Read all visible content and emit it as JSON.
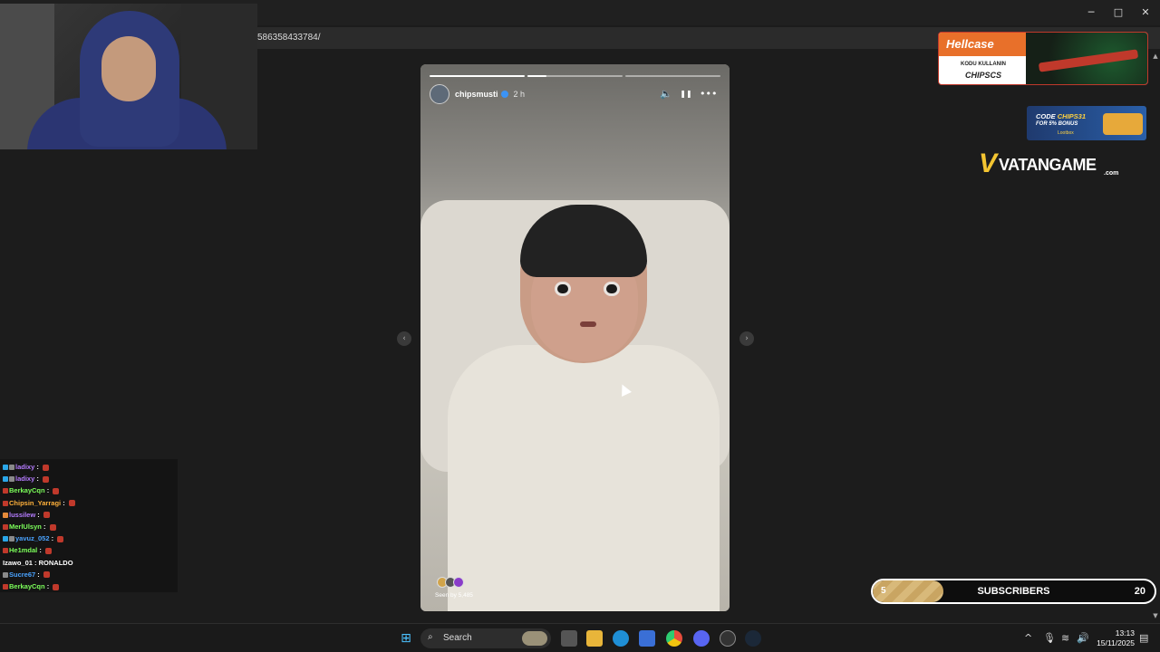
{
  "browser": {
    "url": "586358433784/",
    "controls": {
      "minimize": "─",
      "maximize": "□",
      "close": "✕"
    }
  },
  "chat": {
    "messages": [
      {
        "user": "ladixy",
        "color": "#b57cff",
        "badges": [
          "#2aa6e8",
          "#8a8a8a"
        ],
        "emote": true,
        "text": ""
      },
      {
        "user": "ladixy",
        "color": "#b57cff",
        "badges": [
          "#2aa6e8",
          "#8a8a8a"
        ],
        "emote": true,
        "text": ""
      },
      {
        "user": "BerkayCqn",
        "color": "#7cff5a",
        "badges": [
          "#c0392b"
        ],
        "emote": true,
        "text": ""
      },
      {
        "user": "Chipsin_Yarragi",
        "color": "#ffb03a",
        "badges": [
          "#c0392b"
        ],
        "emote": true,
        "text": ""
      },
      {
        "user": "lussilew",
        "color": "#b57cff",
        "badges": [
          "#e58a3a"
        ],
        "emote": true,
        "text": ""
      },
      {
        "user": "MerlUlsyn",
        "color": "#7cff5a",
        "badges": [
          "#c0392b"
        ],
        "emote": true,
        "text": ""
      },
      {
        "user": "yavuz_052",
        "color": "#4aa3ff",
        "badges": [
          "#2aa6e8",
          "#8a8a8a"
        ],
        "emote": true,
        "text": ""
      },
      {
        "user": "He1mdal",
        "color": "#7cff5a",
        "badges": [
          "#c0392b"
        ],
        "emote": true,
        "text": ""
      },
      {
        "user": "Izawo_01",
        "color": "#ffffff",
        "badges": [],
        "emote": false,
        "text": "RONALDO"
      },
      {
        "user": "Sucre67",
        "color": "#4aa3ff",
        "badges": [
          "#8a8a8a"
        ],
        "emote": true,
        "text": ""
      },
      {
        "user": "BerkayCqn",
        "color": "#7cff5a",
        "badges": [
          "#c0392b"
        ],
        "emote": true,
        "text": ""
      }
    ]
  },
  "story": {
    "username": "chipsmusti",
    "time": "2 h",
    "seen_by": "Seen by 5,485",
    "segments_total": 3,
    "segments_done": 1,
    "current_segment_progress": 0.2,
    "controls": {
      "mute": "🔈",
      "pause": "❚❚",
      "more": "•••"
    },
    "nav": {
      "prev": "‹",
      "next": "›"
    }
  },
  "ads": {
    "hellcase": {
      "brand": "Hellcase",
      "line1": "KODU KULLANIN",
      "line2": "CHIPSCS"
    },
    "lootbox": {
      "code_prefix": "CODE",
      "code": "CHIPS31",
      "bonus": "FOR 5% BONUS",
      "brand": "Lootbox"
    },
    "vatan": {
      "mark": "V",
      "name": "VATANGAME",
      "tld": ".com"
    }
  },
  "sub_goal": {
    "current": "5",
    "label": "SUBSCRIBERS",
    "goal": "20",
    "progress": 0.25
  },
  "taskbar": {
    "search_placeholder": "Search",
    "time": "13:13",
    "date": "15/11/2025",
    "apps": [
      "windows-start",
      "task-view",
      "file-explorer",
      "edge",
      "store",
      "chrome",
      "discord",
      "obs",
      "steam"
    ]
  },
  "colors": {
    "hellcase_orange": "#e8702a",
    "vatan_gold": "#f4c531",
    "sub_fill": "#d8b97a"
  }
}
